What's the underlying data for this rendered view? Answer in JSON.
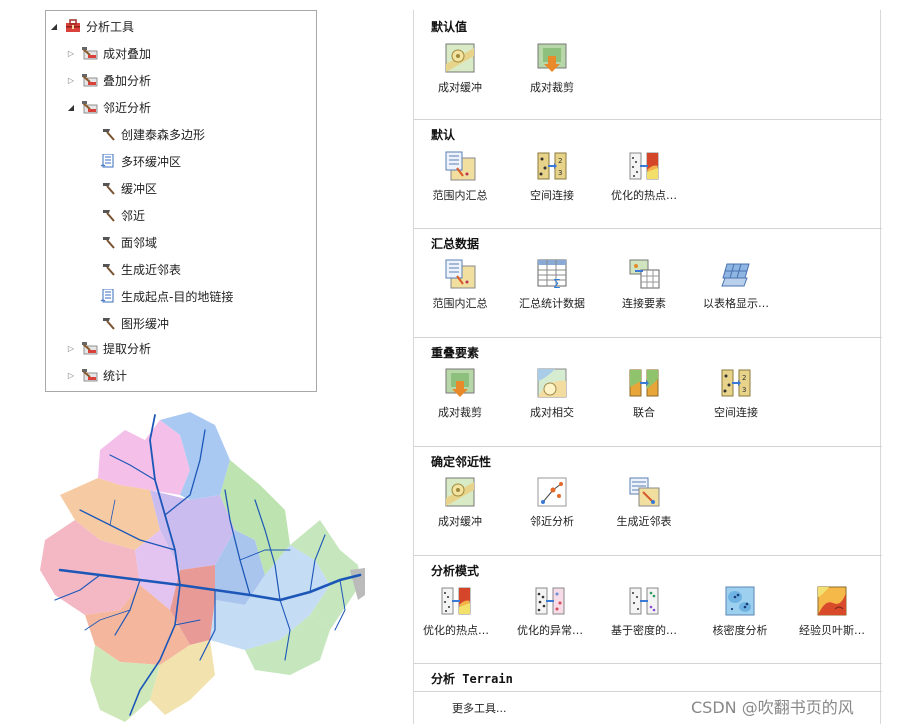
{
  "tree": {
    "root": {
      "label": "分析工具"
    },
    "groups": [
      {
        "label": "成对叠加"
      },
      {
        "label": "叠加分析"
      },
      {
        "label": "邻近分析"
      }
    ],
    "proximity_tools": [
      {
        "label": "创建泰森多边形",
        "icon": "hammer-icon"
      },
      {
        "label": "多环缓冲区",
        "icon": "script-icon"
      },
      {
        "label": "缓冲区",
        "icon": "hammer-icon"
      },
      {
        "label": "邻近",
        "icon": "hammer-icon"
      },
      {
        "label": "面邻域",
        "icon": "hammer-icon"
      },
      {
        "label": "生成近邻表",
        "icon": "hammer-icon"
      },
      {
        "label": "生成起点-目的地链接",
        "icon": "script-icon"
      },
      {
        "label": "图形缓冲",
        "icon": "hammer-icon"
      }
    ],
    "tail_groups": [
      {
        "label": "提取分析"
      },
      {
        "label": "统计"
      }
    ]
  },
  "gallery": {
    "sections": [
      {
        "title": "默认值",
        "tools": [
          {
            "label": "成对缓冲",
            "icon": "buffer-icon"
          },
          {
            "label": "成对裁剪",
            "icon": "clip-icon"
          }
        ]
      },
      {
        "title": "默认",
        "tools": [
          {
            "label": "范围内汇总",
            "icon": "summarize-within-icon"
          },
          {
            "label": "空间连接",
            "icon": "spatial-join-icon"
          },
          {
            "label": "优化的热点…",
            "icon": "hot-spot-icon"
          }
        ]
      },
      {
        "title": "汇总数据",
        "tools": [
          {
            "label": "范围内汇总",
            "icon": "summarize-within-icon"
          },
          {
            "label": "汇总统计数据",
            "icon": "summary-statistics-icon"
          },
          {
            "label": "连接要素",
            "icon": "join-features-icon"
          },
          {
            "label": "以表格显示…",
            "icon": "tabulate-icon"
          }
        ]
      },
      {
        "title": "重叠要素",
        "tools": [
          {
            "label": "成对裁剪",
            "icon": "clip-icon"
          },
          {
            "label": "成对相交",
            "icon": "intersect-icon"
          },
          {
            "label": "联合",
            "icon": "union-icon"
          },
          {
            "label": "空间连接",
            "icon": "spatial-join-icon"
          }
        ]
      },
      {
        "title": "确定邻近性",
        "tools": [
          {
            "label": "成对缓冲",
            "icon": "buffer-icon"
          },
          {
            "label": "邻近分析",
            "icon": "near-icon"
          },
          {
            "label": "生成近邻表",
            "icon": "near-table-icon"
          }
        ]
      },
      {
        "title": "分析模式",
        "tools": [
          {
            "label": "优化的热点…",
            "icon": "hot-spot-icon"
          },
          {
            "label": "优化的异常…",
            "icon": "outlier-icon"
          },
          {
            "label": "基于密度的…",
            "icon": "density-cluster-icon"
          },
          {
            "label": "核密度分析",
            "icon": "kernel-density-icon"
          },
          {
            "label": "经验贝叶斯…",
            "icon": "bayesian-kriging-icon"
          }
        ]
      },
      {
        "title": "分析 Terrain",
        "tools": []
      }
    ],
    "more_tools": "更多工具..."
  },
  "watermark": "CSDN @吹翻书页的风"
}
